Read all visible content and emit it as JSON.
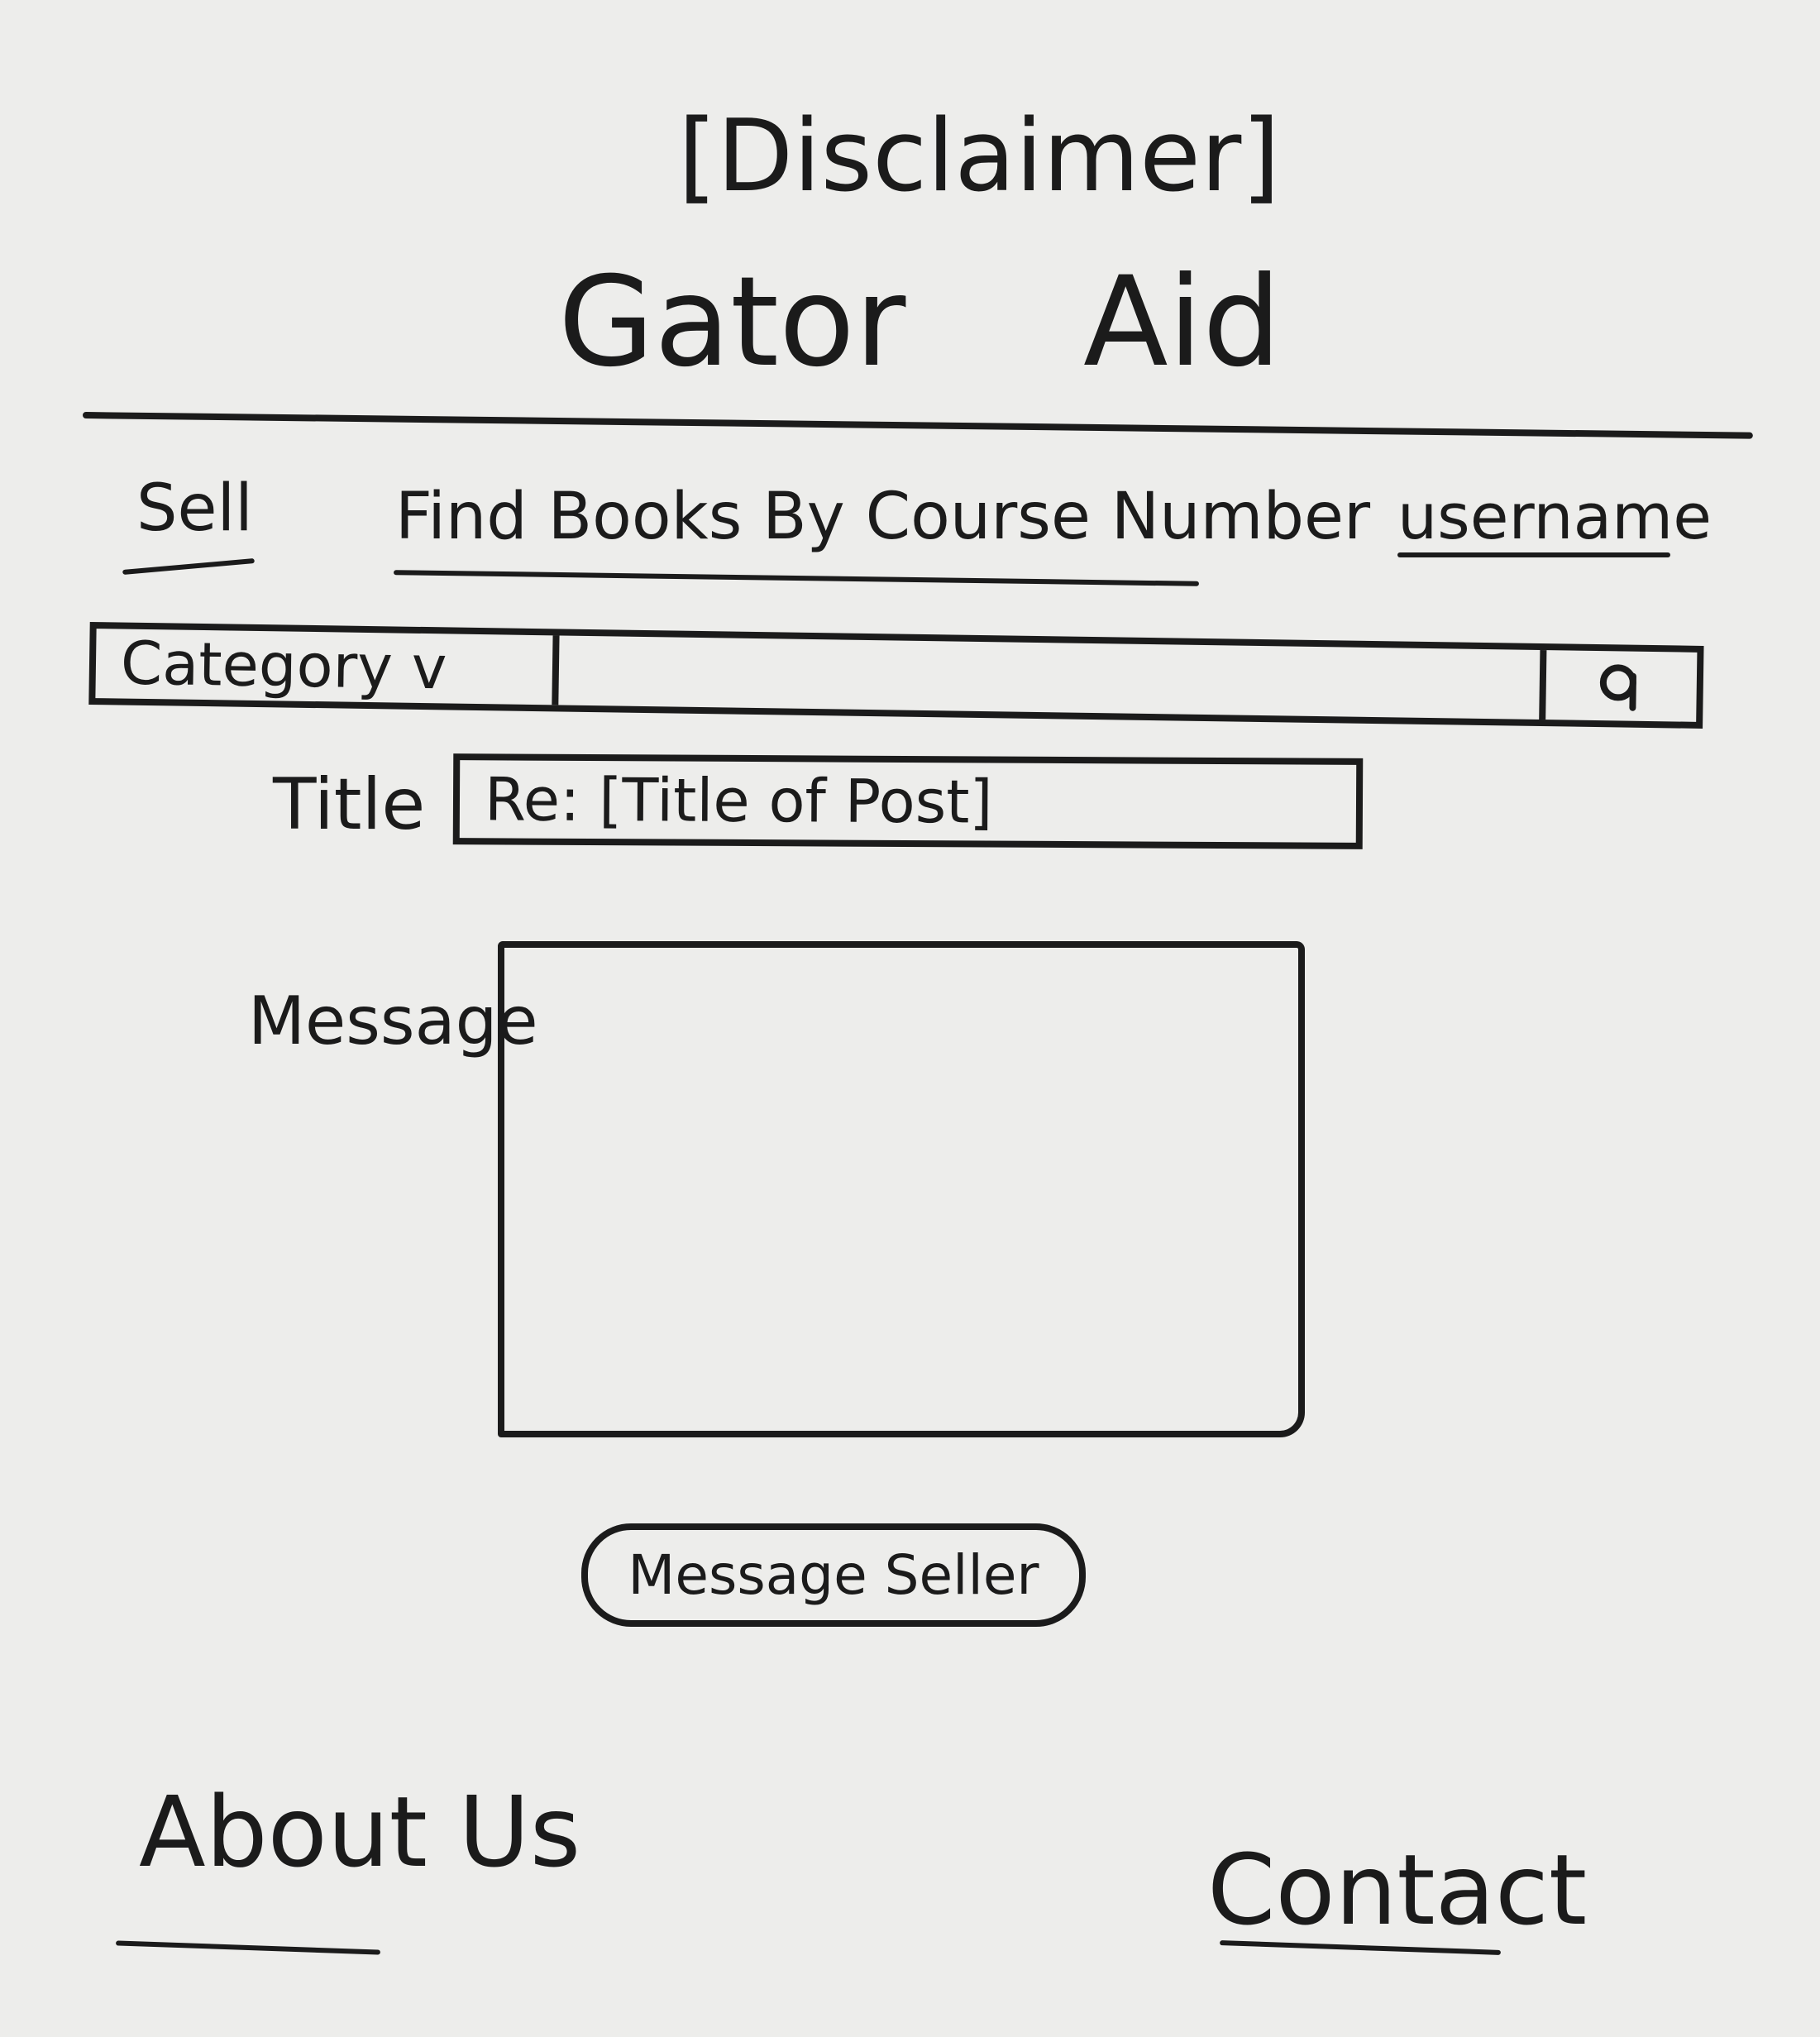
{
  "header": {
    "disclaimer": "[Disclaimer]",
    "brand_first": "Gator",
    "brand_second": "Aid"
  },
  "nav": {
    "sell": "Sell",
    "find_books": "Find Books By Course Number",
    "username": "username"
  },
  "search": {
    "category_label": "Category v",
    "query": "",
    "button_icon": "search-icon"
  },
  "form": {
    "title_label": "Title",
    "title_value": "Re: [Title of Post]",
    "message_label": "Message",
    "message_value": "",
    "submit_label": "Message Seller"
  },
  "footer": {
    "about": "About Us",
    "contact": "Contact"
  }
}
